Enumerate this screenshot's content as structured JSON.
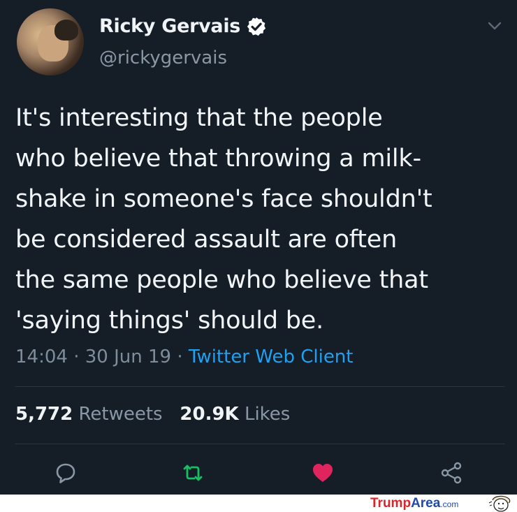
{
  "tweet": {
    "author": {
      "name": "Ricky Gervais",
      "handle": "@rickygervais",
      "verified": true
    },
    "text": "It's interesting that the people\nwho believe that throwing a milk-\nshake in someone's face shouldn't\nbe considered assault are often\nthe same people who believe that\n'saying things' should be.",
    "time": "14:04",
    "date": "30 Jun 19",
    "separator": " · ",
    "client": "Twitter Web Client",
    "stats": {
      "retweets": "5,772",
      "retweets_label": "Retweets",
      "likes": "20.9K",
      "likes_label": "Likes"
    },
    "actions": [
      "reply-icon",
      "retweet-icon",
      "like-icon",
      "share-icon"
    ],
    "colors": {
      "background": "#151d27",
      "link": "#1da1f2",
      "retweet": "#17bf63",
      "like": "#e0245e"
    }
  },
  "footer": {
    "brand_trump": "Trump",
    "brand_area": "Area",
    "brand_com": ".com"
  }
}
